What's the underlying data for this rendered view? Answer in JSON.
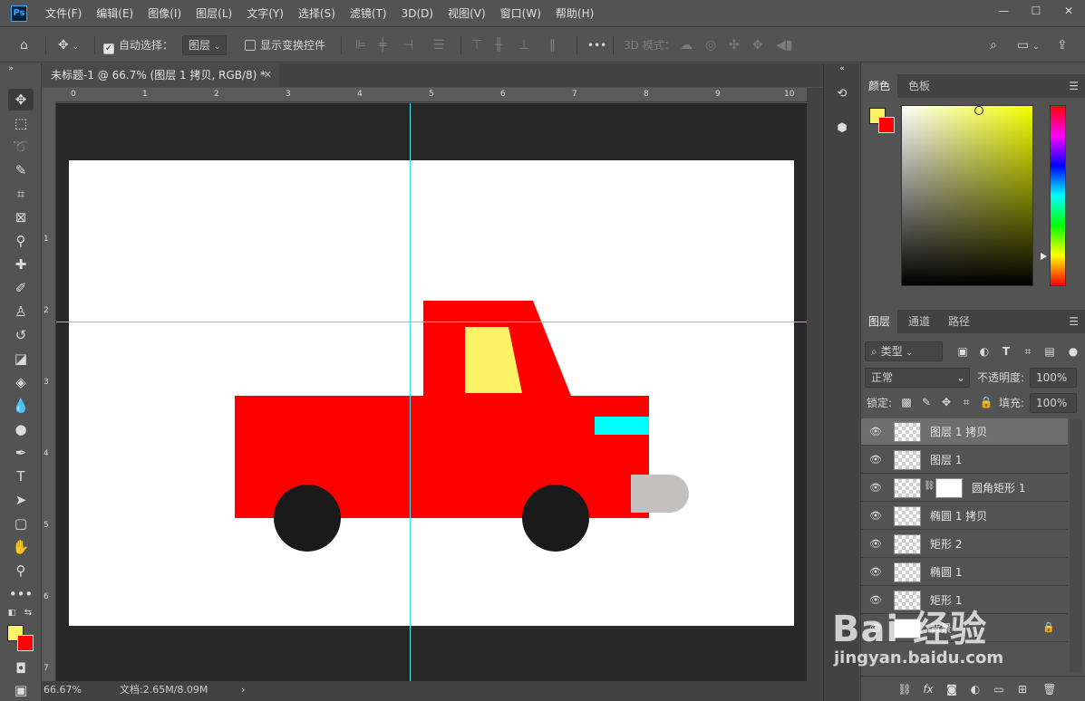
{
  "app": {
    "logo": "Ps",
    "menu": [
      "文件(F)",
      "编辑(E)",
      "图像(I)",
      "图层(L)",
      "文字(Y)",
      "选择(S)",
      "滤镜(T)",
      "3D(D)",
      "视图(V)",
      "窗口(W)",
      "帮助(H)"
    ],
    "window_controls": [
      "—",
      "☐",
      "✕"
    ]
  },
  "options_bar": {
    "auto_select_label": "自动选择：",
    "auto_select_checked": true,
    "auto_select_target": "图层",
    "show_transform_label": "显示变换控件",
    "show_transform_checked": false,
    "more": "•••",
    "mode_3d_label": "3D 模式："
  },
  "document": {
    "tab_title": "未标题-1 @ 66.7% (图层 1 拷贝, RGB/8) *",
    "tab_close": "✕",
    "ruler_top_labels": [
      "0",
      "1",
      "2",
      "3",
      "4",
      "5",
      "6",
      "7",
      "8",
      "9",
      "10"
    ],
    "ruler_left_labels": [
      "1",
      "2",
      "3",
      "4",
      "5",
      "6",
      "7"
    ],
    "zoom": "66.67%",
    "doc_info": "文档:2.65M/8.09M",
    "status_arrow": "›"
  },
  "colors": {
    "foreground": "#fcf366",
    "background": "#ff0000",
    "guide": "#3ce6f0",
    "truck_body": "#ff0000",
    "truck_window": "#fcf366",
    "truck_light": "#00ffff",
    "truck_bumper": "#c4c0c0",
    "wheel": "#1a1a1a"
  },
  "color_panel": {
    "tabs": [
      "颜色",
      "色板"
    ],
    "active_tab": 0,
    "menu": "☰"
  },
  "layers_panel": {
    "tabs": [
      "图层",
      "通道",
      "路径"
    ],
    "active_tab": 0,
    "filter_kind": "类型",
    "blend_mode": "正常",
    "opacity_label": "不透明度:",
    "opacity_value": "100%",
    "lock_label": "锁定:",
    "fill_label": "填充:",
    "fill_value": "100%",
    "layers": [
      {
        "name": "图层 1 拷贝",
        "selected": true,
        "mask": false
      },
      {
        "name": "图层 1",
        "selected": false,
        "mask": false
      },
      {
        "name": "圆角矩形 1",
        "selected": false,
        "mask": true
      },
      {
        "name": "椭圆 1 拷贝",
        "selected": false,
        "mask": false
      },
      {
        "name": "矩形 2",
        "selected": false,
        "mask": false
      },
      {
        "name": "椭圆 1",
        "selected": false,
        "mask": false
      },
      {
        "name": "矩形 1",
        "selected": false,
        "mask": false
      },
      {
        "name": "背景",
        "selected": false,
        "mask": false,
        "locked": true
      }
    ]
  },
  "watermark": {
    "top": "Bai 经验",
    "bottom": "jingyan.baidu.com"
  }
}
